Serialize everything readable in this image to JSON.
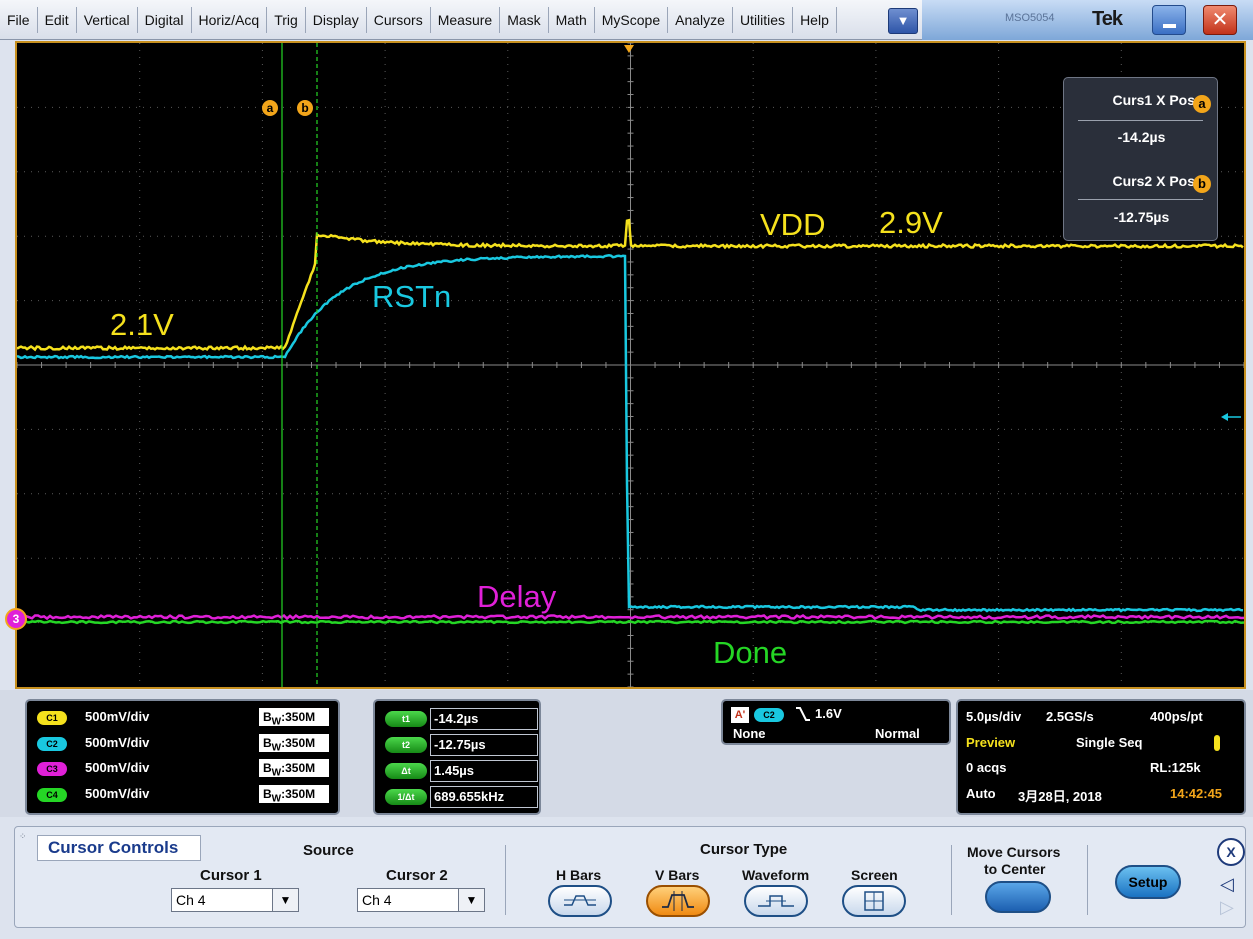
{
  "menu": {
    "items": [
      "File",
      "Edit",
      "Vertical",
      "Digital",
      "Horiz/Acq",
      "Trig",
      "Display",
      "Cursors",
      "Measure",
      "Mask",
      "Math",
      "MyScope",
      "Analyze",
      "Utilities",
      "Help"
    ],
    "dropdown_icon": "chevron-down-icon",
    "model": "MSO5054",
    "brand": "Tek"
  },
  "waveform_labels": {
    "vdd_start": "2.1V",
    "vdd_name": "VDD",
    "vdd_end": "2.9V",
    "rstn": "RSTn",
    "delay": "Delay",
    "done": "Done"
  },
  "markers": {
    "cursor_a": "a",
    "cursor_b": "b",
    "ch_ref": "3"
  },
  "cursor_readout": {
    "curs1_title": "Curs1 X Pos",
    "curs1_value": "-14.2µs",
    "curs2_title": "Curs2 X Pos",
    "curs2_value": "-12.75µs"
  },
  "channels": [
    {
      "tag": "C1",
      "scale": "500mV/div",
      "bw": "350M",
      "color": "#f5e11d"
    },
    {
      "tag": "C2",
      "scale": "500mV/div",
      "bw": "350M",
      "color": "#19c8e0"
    },
    {
      "tag": "C3",
      "scale": "500mV/div",
      "bw": "350M",
      "color": "#e020d8"
    },
    {
      "tag": "C4",
      "scale": "500mV/div",
      "bw": "350M",
      "color": "#25d625"
    }
  ],
  "bw_prefix": "B",
  "bw_sub": "W",
  "cursor_meas": [
    {
      "tag": "t1",
      "value": "-14.2µs"
    },
    {
      "tag": "t2",
      "value": "-12.75µs"
    },
    {
      "tag": "Δt",
      "value": "1.45µs"
    },
    {
      "tag": "1/Δt",
      "value": "689.655kHz"
    }
  ],
  "trigger": {
    "a_tag": "A'",
    "source": "C2",
    "level": "1.6V",
    "coupling": "None",
    "mode": "Normal"
  },
  "acq": {
    "timebase": "5.0µs/div",
    "sample_rate": "2.5GS/s",
    "resolution": "400ps/pt",
    "preview": "Preview",
    "run_mode": "Single Seq",
    "acqs": "0 acqs",
    "record_length": "RL:125k",
    "trig_mode": "Auto",
    "date": "3月28日, 2018",
    "time": "14:42:45"
  },
  "controls": {
    "title": "Cursor Controls",
    "source_label": "Source",
    "cursor1_label": "Cursor 1",
    "cursor1_value": "Ch 4",
    "cursor2_label": "Cursor 2",
    "cursor2_value": "Ch 4",
    "cursor_type_label": "Cursor Type",
    "types": [
      "H Bars",
      "V Bars",
      "Waveform",
      "Screen"
    ],
    "active_type": "V Bars",
    "move_label_1": "Move Cursors",
    "move_label_2": "to Center",
    "setup_label": "Setup",
    "close_label": "X"
  }
}
